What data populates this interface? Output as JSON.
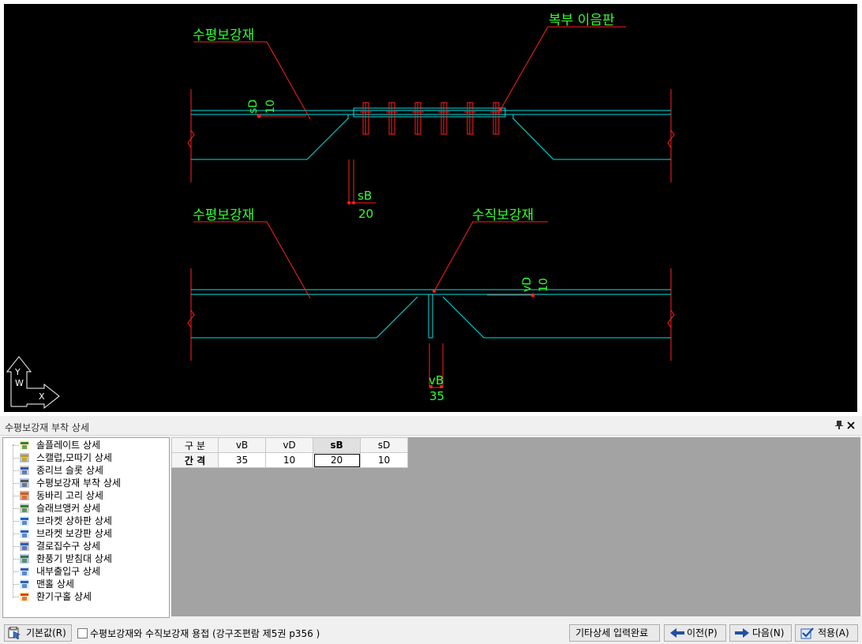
{
  "cad": {
    "labels": {
      "horizontal_stiffener_top": "수평보강재",
      "web_splice_plate": "복부 이음판",
      "horizontal_stiffener_bottom": "수평보강재",
      "vertical_stiffener": "수직보강재",
      "sD_label": "sD",
      "sD_value": "10",
      "sB_label": "sB",
      "sB_value": "20",
      "vD_label": "vD",
      "vD_value": "10",
      "vB_label": "vB",
      "vB_value": "35",
      "ucs_w": "W",
      "ucs_y": "Y",
      "ucs_x": "X"
    },
    "colors": {
      "background": "#000000",
      "line_cyan": "#00e5e5",
      "line_red": "#ff2020",
      "text_green": "#33ff33"
    }
  },
  "panel": {
    "title": "수평보강재 부착 상세",
    "pin_icon": "⊓",
    "close_icon": "✕"
  },
  "tree": {
    "items": [
      {
        "label": "솔플레이트 상세",
        "icon": "sole-plate-icon"
      },
      {
        "label": "스캘럽,모따기 상세",
        "icon": "scallop-icon"
      },
      {
        "label": "종리브 슬롯 상세",
        "icon": "rib-slot-icon"
      },
      {
        "label": "수평보강재 부착 상세",
        "icon": "horizontal-stiffener-icon"
      },
      {
        "label": "동바리 고리 상세",
        "icon": "shoring-ring-icon"
      },
      {
        "label": "슬래브앵커 상세",
        "icon": "slab-anchor-icon"
      },
      {
        "label": "브라켓 상하판 상세",
        "icon": "bracket-flange-icon"
      },
      {
        "label": "브라켓 보강판 상세",
        "icon": "bracket-stiffener-icon"
      },
      {
        "label": "결로집수구 상세",
        "icon": "drain-icon"
      },
      {
        "label": "환풍기 받침대 상세",
        "icon": "fan-support-icon"
      },
      {
        "label": "내부출입구 상세",
        "icon": "access-door-icon"
      },
      {
        "label": "맨홀 상세",
        "icon": "manhole-icon"
      },
      {
        "label": "환기구홀 상세",
        "icon": "vent-hole-icon"
      }
    ]
  },
  "grid": {
    "header_label": "구 분",
    "row_label": "간 격",
    "columns": [
      "vB",
      "vD",
      "sB",
      "sD"
    ],
    "values": [
      "35",
      "10",
      "20",
      "10"
    ],
    "selected_column": "sB"
  },
  "bottom": {
    "default_button": "기본값(R)",
    "weld_checkbox_label": "수평보강재와 수직보강재 용접 (강구조편람 제5권 p356 )",
    "weld_checked": false,
    "complete_button": "기타상세 입력완료",
    "prev_button": "이전(P)",
    "next_button": "다음(N)",
    "apply_button": "적용(A)"
  }
}
